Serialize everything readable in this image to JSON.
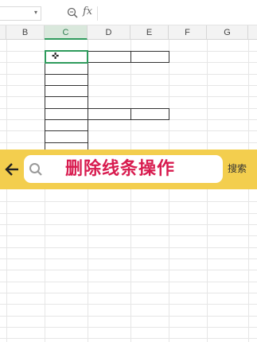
{
  "formula_bar": {
    "fx_label": "fx"
  },
  "columns": [
    {
      "label": "B",
      "selected": false
    },
    {
      "label": "C",
      "selected": true
    },
    {
      "label": "D",
      "selected": false
    },
    {
      "label": "E",
      "selected": false
    },
    {
      "label": "F",
      "selected": false
    },
    {
      "label": "G",
      "selected": false
    }
  ],
  "search": {
    "query": "删除线条操作",
    "button_label": "搜索"
  },
  "colors": {
    "accent_green": "#2e9b5c",
    "search_strip": "#f3ce4e",
    "query_text": "#d81b4f"
  },
  "icons": [
    "chevron-down-icon",
    "zoom-icon",
    "fx-icon",
    "crosshair-cursor-icon",
    "back-arrow-icon",
    "search-icon"
  ]
}
